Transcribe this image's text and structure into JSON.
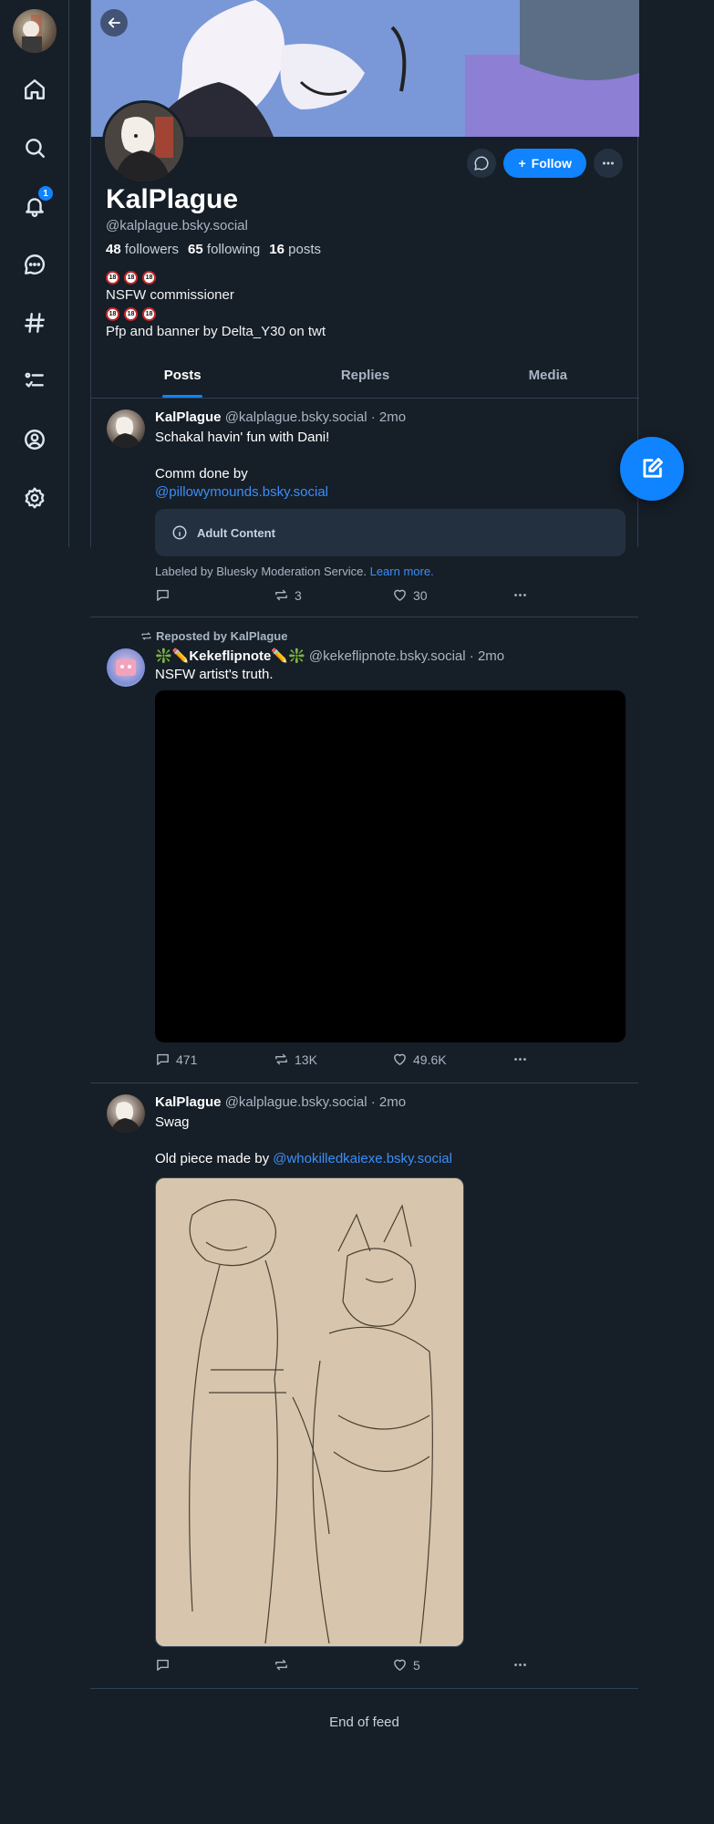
{
  "nav": {
    "notifications_badge": "1",
    "icons": [
      "home-icon",
      "search-icon",
      "bell-icon",
      "chat-icon",
      "hashtag-icon",
      "list-icon",
      "profile-icon",
      "settings-icon"
    ]
  },
  "profile": {
    "display_name": "KalPlague",
    "handle": "@kalplague.bsky.social",
    "followers_count": "48",
    "followers_label": "followers",
    "following_count": "65",
    "following_label": "following",
    "posts_count": "16",
    "posts_label": "posts",
    "bio_badge": "18",
    "bio_line1": "NSFW commissioner",
    "bio_line2": "Pfp and banner by Delta_Y30 on twt",
    "follow_label": "Follow"
  },
  "tabs": [
    "Posts",
    "Replies",
    "Media"
  ],
  "posts": [
    {
      "author": "KalPlague",
      "handle": "@kalplague.bsky.social",
      "time": "· 2mo",
      "text_line1": "Schakal havin' fun with Dani!",
      "text_line2": "Comm done by",
      "mention": "@pillowymounds.bsky.social",
      "content_warning": "Adult Content",
      "label_text": "Labeled by Bluesky Moderation Service.",
      "label_link": "Learn more.",
      "replies": "",
      "reposts": "3",
      "likes": "30"
    },
    {
      "repost_label": "Reposted by KalPlague",
      "author": "❇️✏️Kekeflipnote✏️❇️",
      "handle": "@kekeflipnote.bsky.social",
      "time": "· 2mo",
      "text": "NSFW artist's truth.",
      "replies": "471",
      "reposts": "13K",
      "likes": "49.6K"
    },
    {
      "author": "KalPlague",
      "handle": "@kalplague.bsky.social",
      "time": "· 2mo",
      "text_line1": "Swag",
      "text_prefix": "Old piece made by",
      "mention": "@whokilledkaiexe.bsky.social",
      "replies": "",
      "reposts": "",
      "likes": "5"
    }
  ],
  "end_of_feed": "End of feed",
  "colors": {
    "accent": "#1083fe",
    "background": "#161e27",
    "border": "#2e4052"
  }
}
